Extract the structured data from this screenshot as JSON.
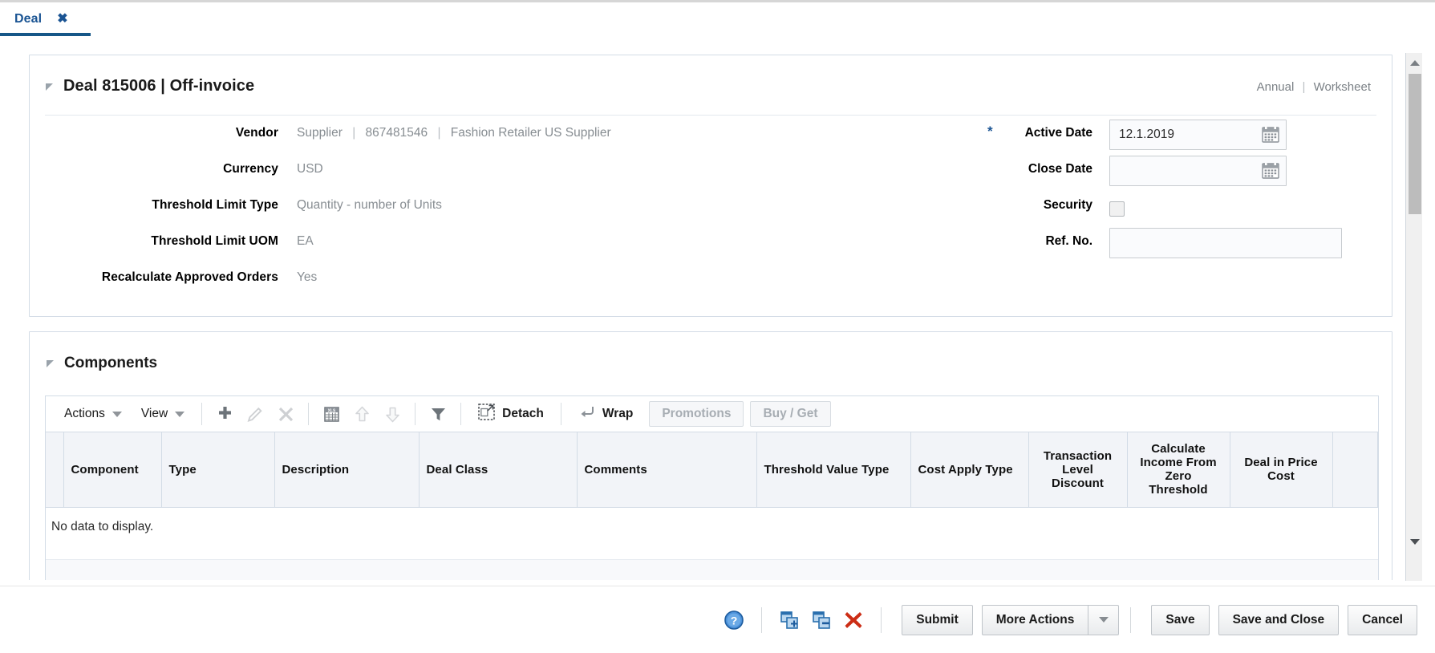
{
  "tab": {
    "label": "Deal",
    "close_icon": "close-icon"
  },
  "deal_section": {
    "title": "Deal 815006  |  Off-invoice",
    "right_meta_left": "Annual",
    "right_meta_sep": "|",
    "right_meta_right": "Worksheet",
    "left_fields": [
      {
        "label": "Vendor",
        "value_parts": [
          "Supplier",
          "867481546",
          "Fashion Retailer US Supplier"
        ]
      },
      {
        "label": "Currency",
        "value": "USD"
      },
      {
        "label": "Threshold Limit Type",
        "value": "Quantity - number of Units"
      },
      {
        "label": "Threshold Limit UOM",
        "value": "EA"
      },
      {
        "label": "Recalculate Approved Orders",
        "value": "Yes"
      }
    ],
    "right_fields": {
      "active_date": {
        "label": "Active Date",
        "required": "*",
        "value": "12.1.2019",
        "placeholder": ""
      },
      "close_date": {
        "label": "Close Date",
        "value": "",
        "placeholder": ""
      },
      "security": {
        "label": "Security",
        "checked": false
      },
      "ref_no": {
        "label": "Ref. No.",
        "value": "",
        "placeholder": ""
      }
    }
  },
  "components_section": {
    "title": "Components",
    "toolbar": {
      "actions": "Actions",
      "view": "View",
      "add_icon": "plus-icon",
      "edit_icon": "pencil-icon",
      "delete_icon": "x-icon",
      "export_icon": "export-to-excel-icon",
      "move_up_icon": "arrow-up-icon",
      "move_down_icon": "arrow-down-icon",
      "filter_icon": "funnel-icon",
      "detach": "Detach",
      "wrap": "Wrap",
      "promotions": "Promotions",
      "buy_get": "Buy / Get"
    },
    "columns": [
      "Component",
      "Type",
      "Description",
      "Deal Class",
      "Comments",
      "Threshold Value Type",
      "Cost Apply Type",
      "Transaction Level Discount",
      "Calculate Income From Zero Threshold",
      "Deal in Price Cost"
    ],
    "empty_message": "No data to display."
  },
  "footer": {
    "help_icon": "help-icon",
    "add_row_icon": "add-record-icon",
    "remove_row_icon": "remove-record-icon",
    "delete_icon": "delete-red-x-icon",
    "submit": "Submit",
    "more_actions": "More Actions",
    "more_actions_arrow": "chevron-down-icon",
    "save": "Save",
    "save_and_close": "Save and Close",
    "cancel": "Cancel"
  },
  "scrollbar": {
    "up_icon": "scroll-up-icon",
    "down_icon": "scroll-down-icon"
  },
  "colors": {
    "accent": "#1a5493",
    "tab_underline": "#165788",
    "required": "#1a5493",
    "delete_red": "#cc2d15"
  }
}
